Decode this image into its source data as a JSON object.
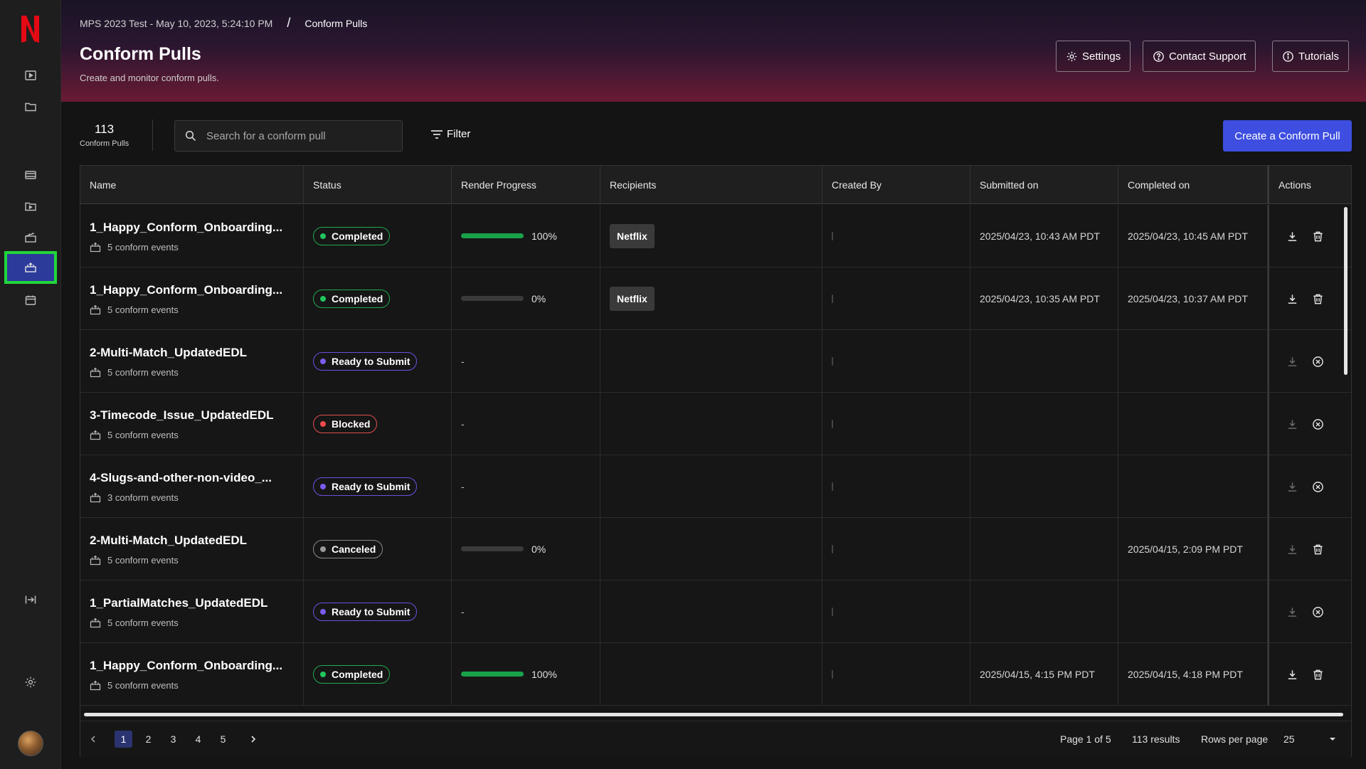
{
  "app": {
    "logo_letter": "N",
    "brand_color": "#e50914",
    "accent": "#3d4ee0"
  },
  "sidebar": {
    "items": [
      {
        "name": "player-icon"
      },
      {
        "name": "folder-icon"
      },
      {
        "name": "film-icon"
      },
      {
        "name": "media-folder-icon"
      },
      {
        "name": "clapper-icon"
      },
      {
        "name": "conform-pulls-icon",
        "active": true
      },
      {
        "name": "calendar-icon"
      },
      {
        "name": "collapse-sidebar-icon"
      },
      {
        "name": "gear-icon"
      }
    ],
    "avatar": "user avatar"
  },
  "header": {
    "breadcrumb": {
      "project": "MPS 2023 Test - May 10, 2023, 5:24:10 PM",
      "separator": "/",
      "current": "Conform Pulls"
    },
    "title": "Conform Pulls",
    "subtitle": "Create and monitor conform pulls.",
    "buttons": {
      "settings": "Settings",
      "contact_support": "Contact Support",
      "tutorials": "Tutorials"
    }
  },
  "toolbar": {
    "count": "113",
    "count_label": "Conform Pulls",
    "search_placeholder": "Search for a conform pull",
    "filter_label": "Filter",
    "create_label": "Create a Conform Pull"
  },
  "table": {
    "columns": [
      "Name",
      "Status",
      "Render Progress",
      "Recipients",
      "Created By",
      "Submitted on",
      "Completed on",
      "Actions"
    ],
    "rows": [
      {
        "name": "1_Happy_Conform_Onboarding...",
        "events": "5 conform events",
        "status": "Completed",
        "status_key": "completed",
        "progress": "100%",
        "progress_value": 100,
        "recipient": "Netflix",
        "submitted": "2025/04/23, 10:43 AM PDT",
        "completed": "2025/04/23, 10:45 AM PDT",
        "action2": "delete"
      },
      {
        "name": "1_Happy_Conform_Onboarding...",
        "events": "5 conform events",
        "status": "Completed",
        "status_key": "completed",
        "progress": "0%",
        "progress_value": 0,
        "recipient": "Netflix",
        "submitted": "2025/04/23, 10:35 AM PDT",
        "completed": "2025/04/23, 10:37 AM PDT",
        "action2": "delete"
      },
      {
        "name": "2-Multi-Match_UpdatedEDL",
        "events": "5 conform events",
        "status": "Ready to Submit",
        "status_key": "ready",
        "progress": "-",
        "recipient": "",
        "submitted": "",
        "completed": "",
        "action2": "cancel"
      },
      {
        "name": "3-Timecode_Issue_UpdatedEDL",
        "events": "5 conform events",
        "status": "Blocked",
        "status_key": "blocked",
        "progress": "-",
        "recipient": "",
        "submitted": "",
        "completed": "",
        "action2": "cancel"
      },
      {
        "name": "4-Slugs-and-other-non-video_...",
        "events": "3 conform events",
        "status": "Ready to Submit",
        "status_key": "ready",
        "progress": "-",
        "recipient": "",
        "submitted": "",
        "completed": "",
        "action2": "cancel"
      },
      {
        "name": "2-Multi-Match_UpdatedEDL",
        "events": "5 conform events",
        "status": "Canceled",
        "status_key": "canceled",
        "progress": "0%",
        "progress_value": 0,
        "recipient": "",
        "submitted": "",
        "completed": "2025/04/15, 2:09 PM PDT",
        "action2": "delete"
      },
      {
        "name": "1_PartialMatches_UpdatedEDL",
        "events": "5 conform events",
        "status": "Ready to Submit",
        "status_key": "ready",
        "progress": "-",
        "recipient": "",
        "submitted": "",
        "completed": "",
        "action2": "cancel"
      },
      {
        "name": "1_Happy_Conform_Onboarding...",
        "events": "5 conform events",
        "status": "Completed",
        "status_key": "completed",
        "progress": "100%",
        "progress_value": 100,
        "recipient": "",
        "submitted": "2025/04/15, 4:15 PM PDT",
        "completed": "2025/04/15, 4:18 PM PDT",
        "action2": "delete"
      }
    ]
  },
  "pagination": {
    "pages": [
      "1",
      "2",
      "3",
      "4",
      "5"
    ],
    "current": "1",
    "page_info": "Page 1 of 5",
    "results": "113 results",
    "rows_label": "Rows per page",
    "rows_value": "25"
  }
}
